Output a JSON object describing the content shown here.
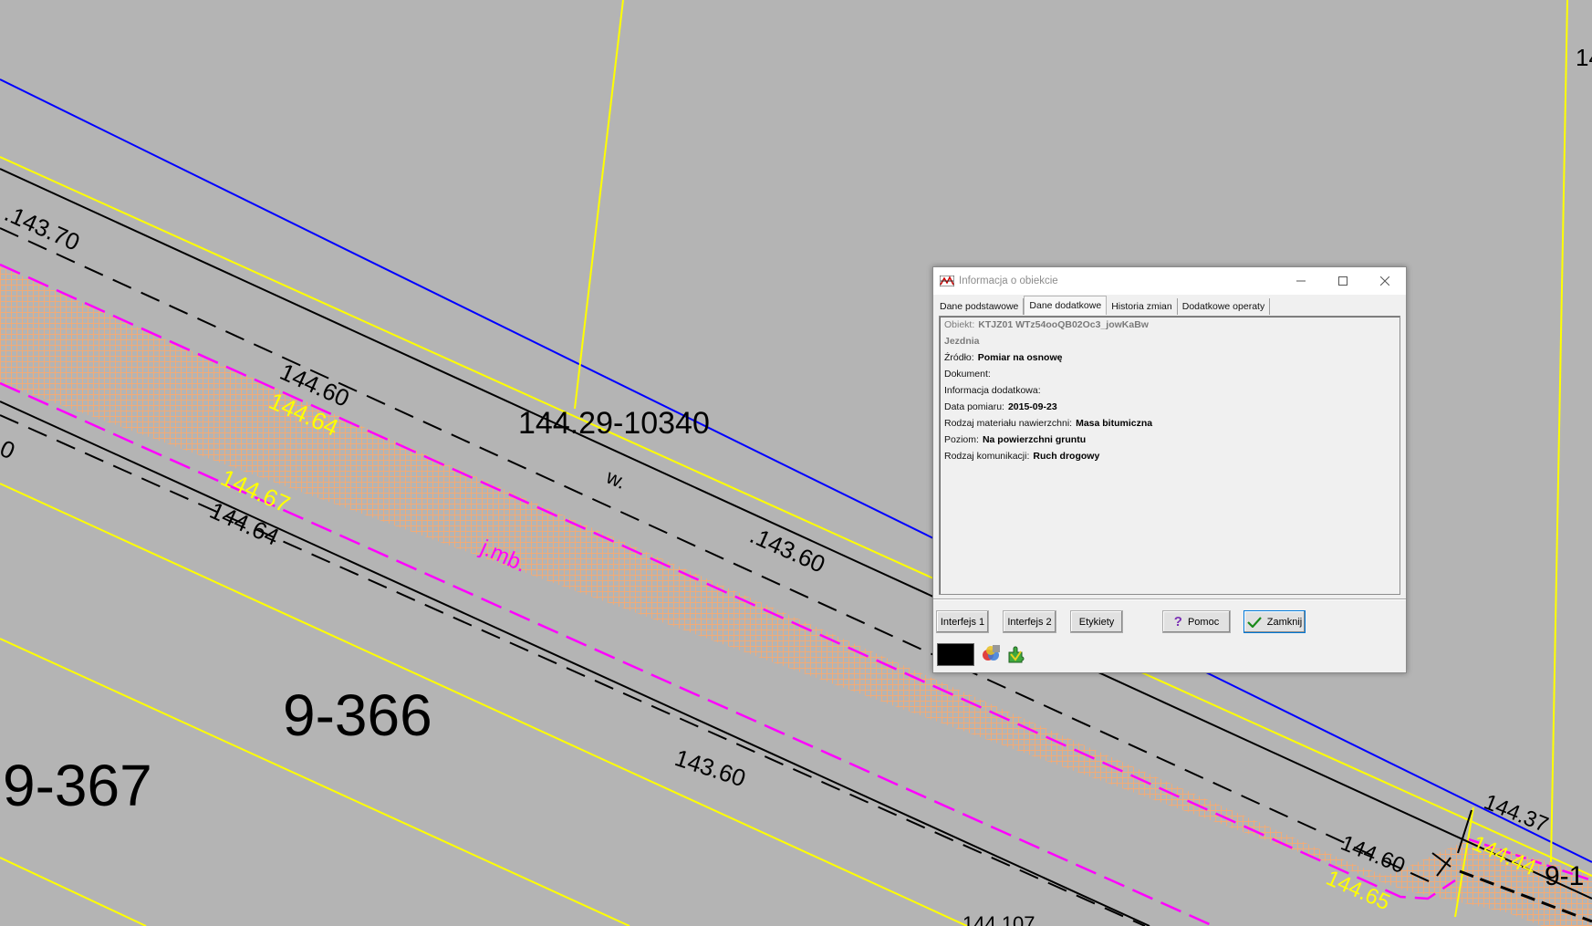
{
  "map": {
    "labels": {
      "elev_14370": ".143.70",
      "elev_14460": "144.60",
      "elev_14464_yellow": "144.64",
      "elev_14467_yellow": "144.67",
      "elev_14464": "144.64",
      "left_edge": "0",
      "point_id": "144.29-10340",
      "w_label": "w.",
      "elev_14360_a": ".143.60",
      "jmb": "j.mb.",
      "parcel_9_366": "9-366",
      "parcel_9_367": "9-367",
      "elev_14360_b": "143.60",
      "elev_14437": "144.37",
      "elev_14444_yellow": "144.44",
      "elev_14460_b": "144.60",
      "elev_14465_yellow": "144.65",
      "parcel_9_1": "9-1",
      "bottom_partial": "144.107",
      "top_right_partial": "14"
    },
    "colors": {
      "background": "#b4b4b4",
      "yellow": "#ffff00",
      "blue": "#0000ff",
      "magenta": "#ff00ff",
      "black": "#000000",
      "road_fill": "#f4ab74"
    }
  },
  "dialog": {
    "title": "Informacja o obiekcie",
    "tabs": [
      "Dane podstawowe",
      "Dane dodatkowe",
      "Historia zmian",
      "Dodatkowe operaty"
    ],
    "active_tab": "Dane dodatkowe",
    "fields": {
      "obiekt_label": "Obiekt:",
      "obiekt_value": "KTJZ01 WTz54ooQB02Oc3_jowKaBw",
      "type": "Jezdnia",
      "zrodlo_label": "Źródło:",
      "zrodlo_value": "Pomiar na osnowę",
      "dokument_label": "Dokument:",
      "info_label": "Informacja dodatkowa:",
      "data_label": "Data pomiaru:",
      "data_value": "2015-09-23",
      "material_label": "Rodzaj materiału nawierzchni:",
      "material_value": "Masa bitumiczna",
      "poziom_label": "Poziom:",
      "poziom_value": "Na powierzchni gruntu",
      "komunikacja_label": "Rodzaj komunikacji:",
      "komunikacja_value": "Ruch drogowy"
    },
    "buttons": {
      "interfejs1": "Interfejs 1",
      "interfejs2": "Interfejs 2",
      "etykiety": "Etykiety",
      "pomoc": "Pomoc",
      "zamknij": "Zamknij"
    },
    "swatch_color": "#000000"
  }
}
